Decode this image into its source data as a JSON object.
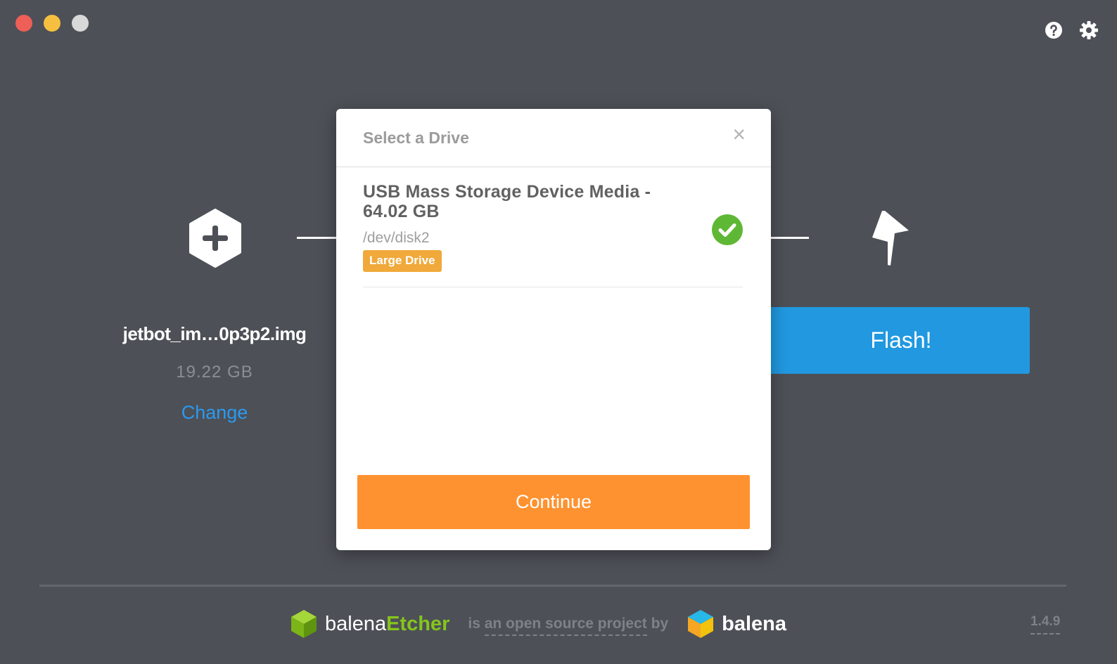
{
  "window": {
    "controls": [
      "close",
      "minimize",
      "maximize"
    ]
  },
  "top_icons": [
    "help-icon",
    "gear-icon"
  ],
  "image_step": {
    "icon": "plus-hexagon-icon",
    "file_name": "jetbot_im…0p3p2.img",
    "file_size": "19.22 GB",
    "change_label": "Change"
  },
  "flash_step": {
    "icon": "lightning-bolt-icon",
    "button_label": "Flash!"
  },
  "modal": {
    "title": "Select a Drive",
    "close_glyph": "×",
    "drives": [
      {
        "name": "USB Mass Storage Device Media - 64.02 GB",
        "path": "/dev/disk2",
        "badge": "Large Drive",
        "selected": true
      }
    ],
    "continue_label": "Continue"
  },
  "footer": {
    "brand_prefix": "balena",
    "brand_suffix": "Etcher",
    "tagline_pre": "is ",
    "tagline_link": "an open source project",
    "tagline_post": " by",
    "company": "balena",
    "version": "1.4.9"
  },
  "colors": {
    "background": "#4d5057",
    "flash_blue": "#2198e0",
    "continue_orange": "#ff9230",
    "badge_orange": "#f0a93a",
    "check_green": "#5fb835",
    "link_blue": "#2a9af0",
    "etcher_green": "#85c51c"
  }
}
